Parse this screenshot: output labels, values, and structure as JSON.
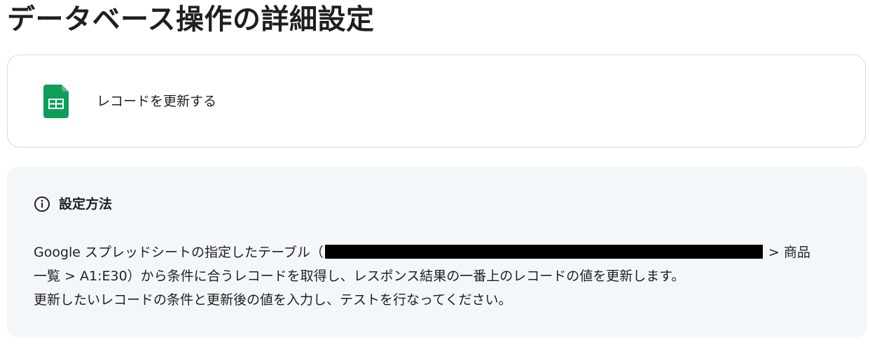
{
  "page": {
    "title": "データベース操作の詳細設定"
  },
  "action_card": {
    "icon": "google-sheets-icon",
    "label": "レコードを更新する",
    "icon_color": "#0f9d58"
  },
  "info_panel": {
    "icon": "info-icon",
    "heading": "設定方法",
    "line1_before_redaction": "Google スプレッドシートの指定したテーブル（",
    "line1_after_redaction": "> 商品",
    "line2": "一覧 > A1:E30）から条件に合うレコードを取得し、レスポンス結果の一番上のレコードの値を更新します。",
    "line3": "更新したいレコードの条件と更新後の値を入力し、テストを行なってください。"
  }
}
